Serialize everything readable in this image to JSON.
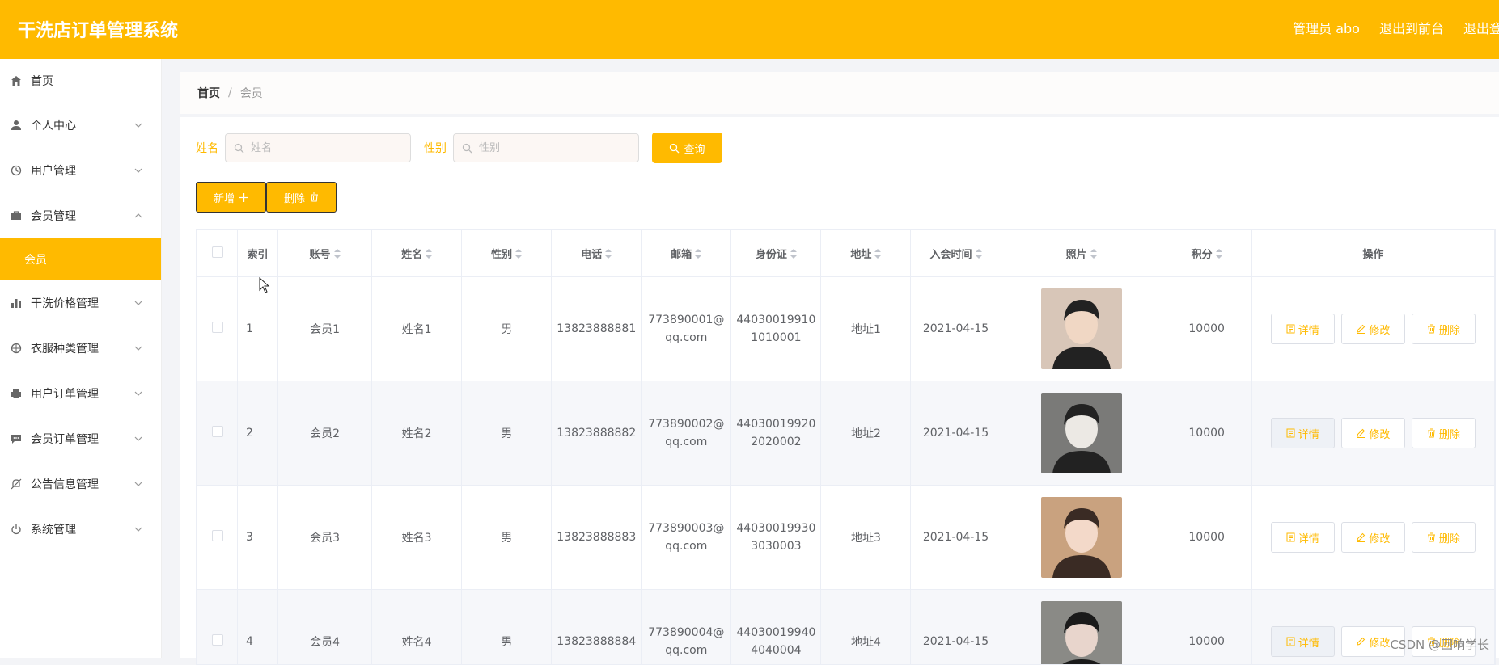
{
  "header": {
    "title": "干洗店订单管理系统",
    "admin": "管理员 abo",
    "front": "退出到前台",
    "logout": "退出登录"
  },
  "sidebar": {
    "items": [
      {
        "label": "首页",
        "icon": "home-icon"
      },
      {
        "label": "个人中心",
        "icon": "user-icon"
      },
      {
        "label": "用户管理",
        "icon": "clock-icon"
      },
      {
        "label": "会员管理",
        "icon": "briefcase-icon",
        "expanded": true,
        "sub": "会员"
      },
      {
        "label": "干洗价格管理",
        "icon": "bar-chart-icon"
      },
      {
        "label": "衣服种类管理",
        "icon": "compass-icon"
      },
      {
        "label": "用户订单管理",
        "icon": "printer-icon"
      },
      {
        "label": "会员订单管理",
        "icon": "chat-icon"
      },
      {
        "label": "公告信息管理",
        "icon": "bell-off-icon"
      },
      {
        "label": "系统管理",
        "icon": "power-icon"
      }
    ]
  },
  "breadcrumb": {
    "home": "首页",
    "sep": "/",
    "current": "会员"
  },
  "search": {
    "name_label": "姓名",
    "name_placeholder": "姓名",
    "gender_label": "性别",
    "gender_placeholder": "性别",
    "button": "查询"
  },
  "actions": {
    "add": "新增",
    "delete": "删除"
  },
  "table": {
    "headers": [
      "索引",
      "账号",
      "姓名",
      "性别",
      "电话",
      "邮箱",
      "身份证",
      "地址",
      "入会时间",
      "照片",
      "积分",
      "操作"
    ],
    "op_labels": {
      "detail": "详情",
      "edit": "修改",
      "delete": "删除"
    },
    "rows": [
      {
        "index": "1",
        "account": "会员1",
        "name": "姓名1",
        "gender": "男",
        "phone": "13823888881",
        "email": "773890001@qq.com",
        "id_card": "440300199101010001",
        "address": "地址1",
        "join_date": "2021-04-15",
        "points": "10000"
      },
      {
        "index": "2",
        "account": "会员2",
        "name": "姓名2",
        "gender": "男",
        "phone": "13823888882",
        "email": "773890002@qq.com",
        "id_card": "440300199202020002",
        "address": "地址2",
        "join_date": "2021-04-15",
        "points": "10000"
      },
      {
        "index": "3",
        "account": "会员3",
        "name": "姓名3",
        "gender": "男",
        "phone": "13823888883",
        "email": "773890003@qq.com",
        "id_card": "440300199303030003",
        "address": "地址3",
        "join_date": "2021-04-15",
        "points": "10000"
      },
      {
        "index": "4",
        "account": "会员4",
        "name": "姓名4",
        "gender": "男",
        "phone": "13823888884",
        "email": "773890004@qq.com",
        "id_card": "440300199404040004",
        "address": "地址4",
        "join_date": "2021-04-15",
        "points": "10000"
      }
    ]
  },
  "watermark": "CSDN @回响学长",
  "colors": {
    "accent": "#ffba00",
    "text": "#606266"
  }
}
